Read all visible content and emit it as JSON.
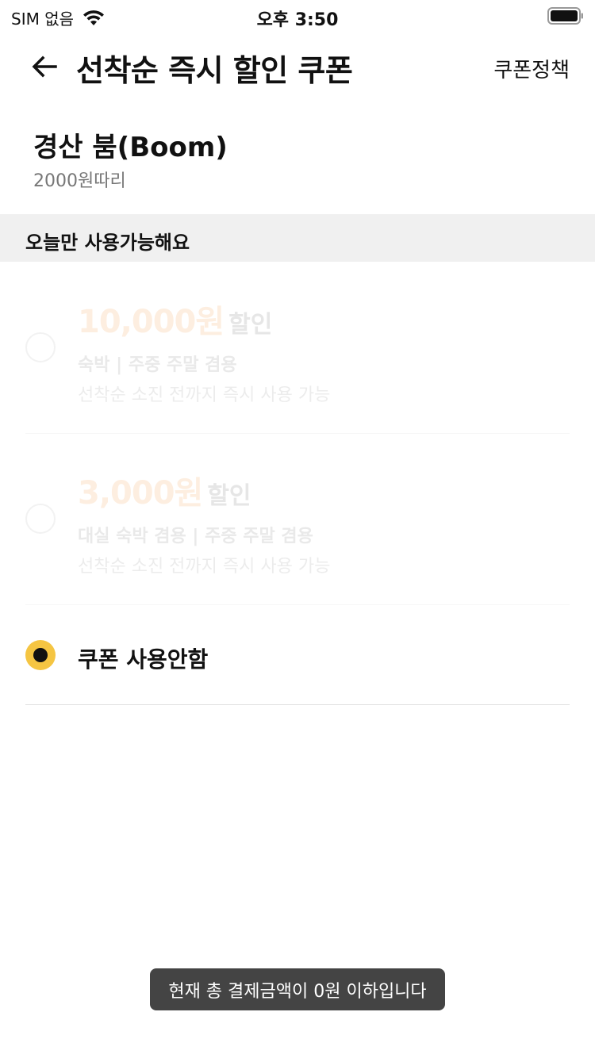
{
  "status_bar": {
    "carrier": "SIM 없음",
    "time": "오후 3:50",
    "icons": [
      "wifi-icon",
      "battery-icon"
    ]
  },
  "nav": {
    "back_icon": "arrow-left-icon",
    "title": "선착순 즉시 할인 쿠폰",
    "policy_link": "쿠폰정책"
  },
  "product": {
    "name": "경산 붐(Boom)",
    "price": "2000원따리"
  },
  "section": {
    "title": "오늘만 사용가능해요"
  },
  "coupons": [
    {
      "amount": "10,000원",
      "discount_word": "할인",
      "conditions": "숙박 | 주중 주말 겸용",
      "note": "선착순 소진 전까지 즉시 사용 가능",
      "state": "disabled"
    },
    {
      "amount": "3,000원",
      "discount_word": "할인",
      "conditions": "대실 숙박 겸용 | 주중 주말 겸용",
      "note": "선착순 소진 전까지 즉시 사용 가능",
      "state": "disabled"
    }
  ],
  "no_coupon": {
    "label": "쿠폰 사용안함",
    "selected": true
  },
  "toast": {
    "message": "현재 총 결제금액이 0원 이하입니다"
  },
  "colors": {
    "accent": "#f5c542",
    "toast_bg": "#444444",
    "section_bg": "#f0f0f0",
    "disabled_amount": "#fdeee0"
  }
}
